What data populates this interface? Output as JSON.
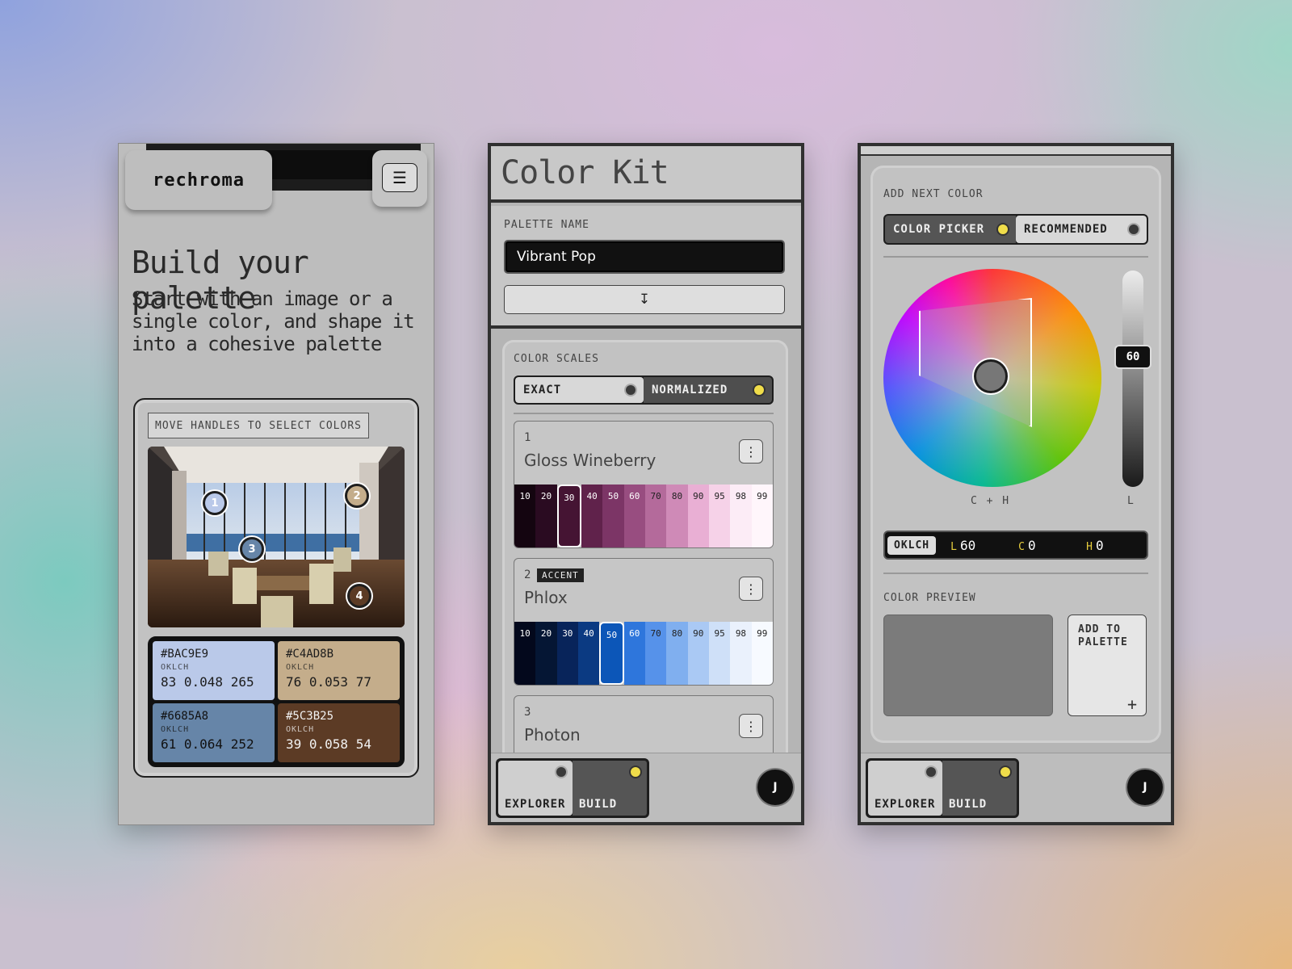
{
  "phone1": {
    "logo": "rechroma",
    "menu_icon": "☰",
    "title": "Build your palette",
    "subtitle": "Start with an image or a single color, and shape it into a cohesive palette",
    "handles_label": "MOVE HANDLES TO SELECT COLORS",
    "handles": [
      "1",
      "2",
      "3",
      "4"
    ],
    "swatches": [
      {
        "hex": "#BAC9E9",
        "space": "OKLCH",
        "value": "83 0.048 265",
        "color": "#BAC9E9",
        "text": "#1c1c1c"
      },
      {
        "hex": "#C4AD8B",
        "space": "OKLCH",
        "value": "76 0.053 77",
        "color": "#C4AD8B",
        "text": "#1c1c1c"
      },
      {
        "hex": "#6685A8",
        "space": "OKLCH",
        "value": "61 0.064 252",
        "color": "#6685A8",
        "text": "#111111"
      },
      {
        "hex": "#5C3B25",
        "space": "OKLCH",
        "value": "39 0.058 54",
        "color": "#5C3B25",
        "text": "#f2f2f2"
      }
    ]
  },
  "phone2": {
    "title": "Color Kit",
    "palette_label": "PALETTE NAME",
    "palette_name": "Vibrant Pop",
    "download_icon": "↧",
    "scales_label": "COLOR SCALES",
    "mode_exact": "EXACT",
    "mode_normalized": "NORMALIZED",
    "stops": [
      "10",
      "20",
      "30",
      "40",
      "50",
      "60",
      "70",
      "80",
      "90",
      "95",
      "98",
      "99"
    ],
    "scales": [
      {
        "num": "1",
        "name": "Gloss Wineberry",
        "badge": "",
        "more": "⋮",
        "colors": [
          "#140510",
          "#2a0b21",
          "#451433",
          "#60224b",
          "#7c3566",
          "#984d80",
          "#b46a9b",
          "#cf8ab7",
          "#e9afd4",
          "#f6d2e8",
          "#fcecf6",
          "#fff6fb"
        ],
        "selected": 2
      },
      {
        "num": "2",
        "name": "Phlox",
        "badge": "ACCENT",
        "more": "⋮",
        "colors": [
          "#03081c",
          "#051634",
          "#08245a",
          "#0b3a82",
          "#0c56b8",
          "#2e76dc",
          "#5692ea",
          "#80afef",
          "#aac9f4",
          "#cfe0f8",
          "#eaf1fc",
          "#f7faff"
        ],
        "selected": 4
      },
      {
        "num": "3",
        "name": "Photon",
        "badge": "",
        "more": "⋮",
        "colors": [],
        "selected": -1
      }
    ],
    "nav": {
      "explorer": "EXPLORER",
      "build": "BUILD",
      "avatar": "J"
    }
  },
  "phone3": {
    "add_label": "ADD NEXT COLOR",
    "tab_picker": "COLOR PICKER",
    "tab_recommended": "RECOMMENDED",
    "l_value": "60",
    "axis_ch": "C + H",
    "axis_l": "L",
    "readout": {
      "space": "OKLCH",
      "l_key": "L",
      "l": "60",
      "c_key": "C",
      "c": "0",
      "h_key": "H",
      "h": "0"
    },
    "preview_label": "COLOR PREVIEW",
    "preview_color": "#7b7b7b",
    "add_button": "ADD TO PALETTE",
    "add_icon": "+",
    "nav": {
      "explorer": "EXPLORER",
      "build": "BUILD",
      "avatar": "J"
    }
  }
}
